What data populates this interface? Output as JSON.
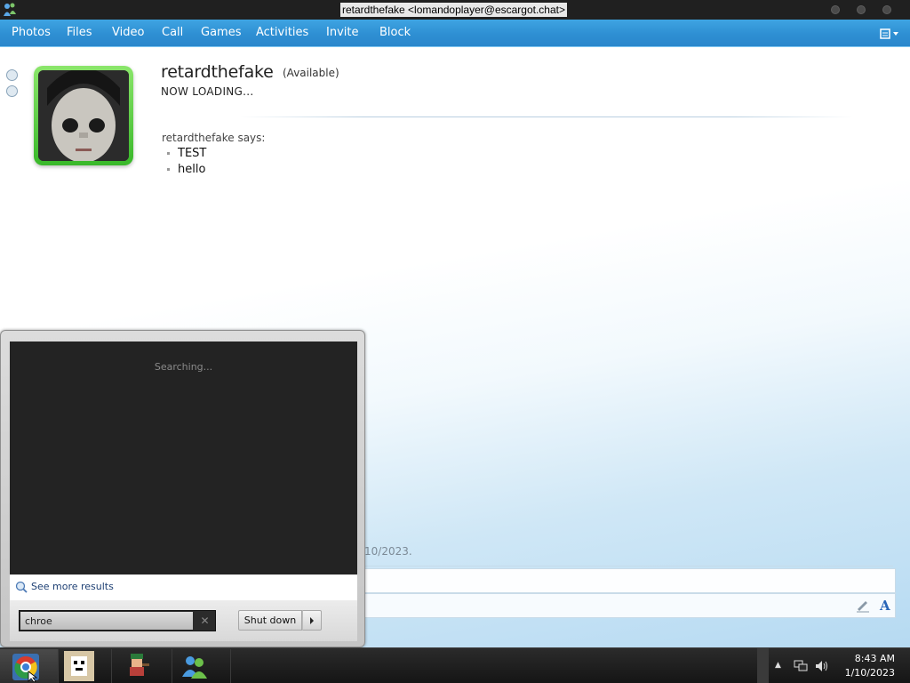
{
  "window": {
    "title": "retardthefake <lomandoplayer@escargot.chat>"
  },
  "menu": {
    "items": [
      "Photos",
      "Files",
      "Video",
      "Call",
      "Games",
      "Activities",
      "Invite",
      "Block"
    ]
  },
  "contact": {
    "name": "retardthefake",
    "status": "(Available)",
    "personal_message": "NOW LOADING..."
  },
  "conversation": {
    "sender_line": "retardthefake says:",
    "messages": [
      "TEST",
      "hello"
    ],
    "date_note": "10/2023."
  },
  "start_menu": {
    "searching_text": "Searching...",
    "see_more": "See more results",
    "search_value": "chroe",
    "shutdown_label": "Shut down"
  },
  "clock": {
    "time": "8:43 AM",
    "date": "1/10/2023"
  },
  "icons": {
    "app": "messenger-icon",
    "taskbar": [
      "chrome-icon",
      "game-sprite-icon",
      "character-icon",
      "messenger-buddies-icon"
    ],
    "tray": [
      "tray-expand-icon",
      "network-icon",
      "volume-icon"
    ]
  },
  "colors": {
    "menubar": "#2e8fd3",
    "avatar_frame": "#39b82a",
    "start_menu_results": "#232323"
  }
}
